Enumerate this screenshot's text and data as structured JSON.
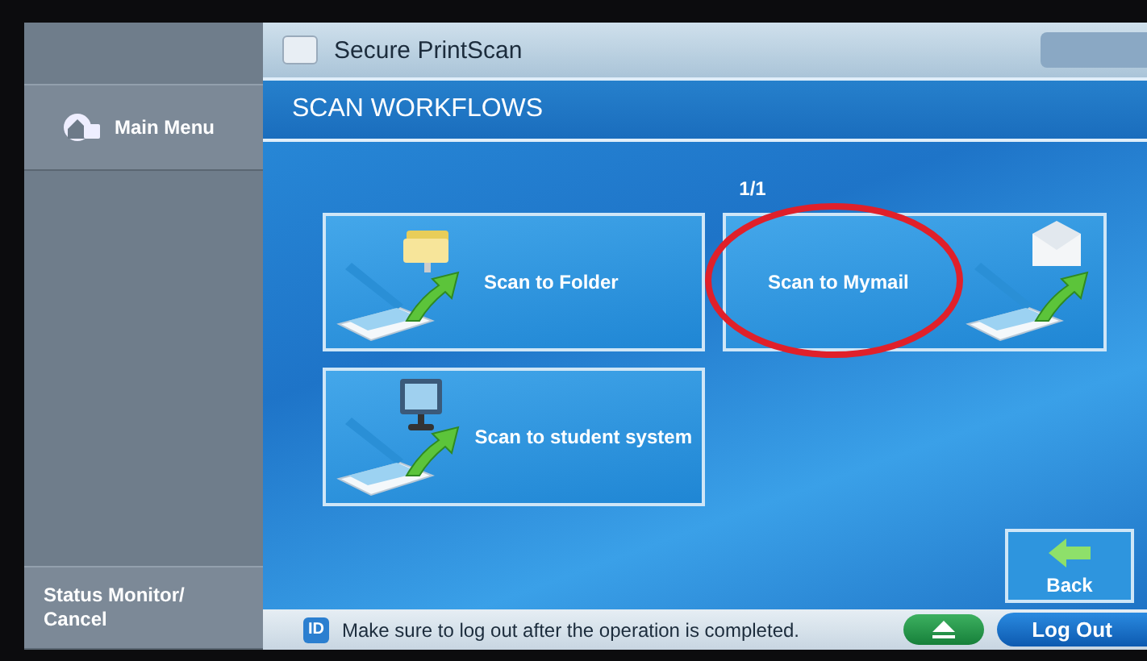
{
  "sidebar": {
    "items": [
      {
        "kind": "home",
        "label": "Main Menu"
      },
      {
        "kind": "plain",
        "label": "Status Monitor/\nCancel"
      }
    ]
  },
  "title_bar": {
    "title": "Secure PrintScan"
  },
  "header": {
    "title": "SCAN WORKFLOWS"
  },
  "page_indicator": "1/1",
  "tiles": [
    {
      "kind": "folder",
      "label": "Scan to Folder",
      "highlighted": false
    },
    {
      "kind": "mail",
      "label": "Scan to Mymail",
      "highlighted": true
    },
    {
      "kind": "monitor",
      "label": "Scan to student system",
      "highlighted": false
    }
  ],
  "back_button": {
    "label": "Back"
  },
  "status_bar": {
    "id_badge": "ID",
    "message": "Make sure to log out after the operation is completed.",
    "logout_label": "Log Out"
  }
}
